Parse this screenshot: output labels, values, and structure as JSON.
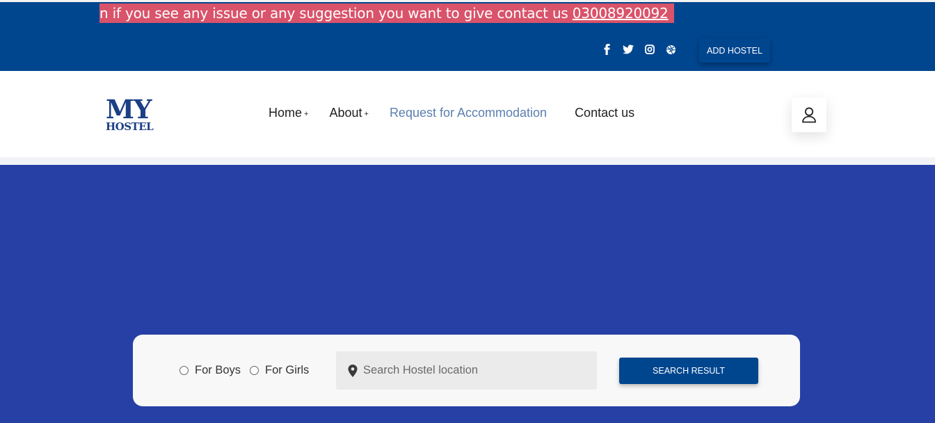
{
  "topbar": {
    "notice_text": "n if you see any issue or any suggestion you want to give contact us ",
    "notice_phone": "03008920092",
    "add_hostel_label": "ADD HOSTEL",
    "socials": [
      "facebook-icon",
      "twitter-icon",
      "instagram-icon",
      "dribbble-icon"
    ]
  },
  "header": {
    "logo": {
      "line1": "MY",
      "line2": "HOSTEL"
    },
    "nav": [
      {
        "label": "Home",
        "suffix": "+"
      },
      {
        "label": "About",
        "suffix": "+"
      },
      {
        "label": "Request for Accommodation",
        "suffix": ""
      },
      {
        "label": "Contact us",
        "suffix": ""
      }
    ]
  },
  "search": {
    "options": [
      "For Boys",
      "For Girls"
    ],
    "placeholder": "Search Hostel location",
    "button_label": "SEARCH RESULT"
  },
  "colors": {
    "topbar_bg": "#00468f",
    "notice_bg": "#d9536a",
    "hero_bg": "#2740a5",
    "nav_active": "#5a7fae"
  }
}
